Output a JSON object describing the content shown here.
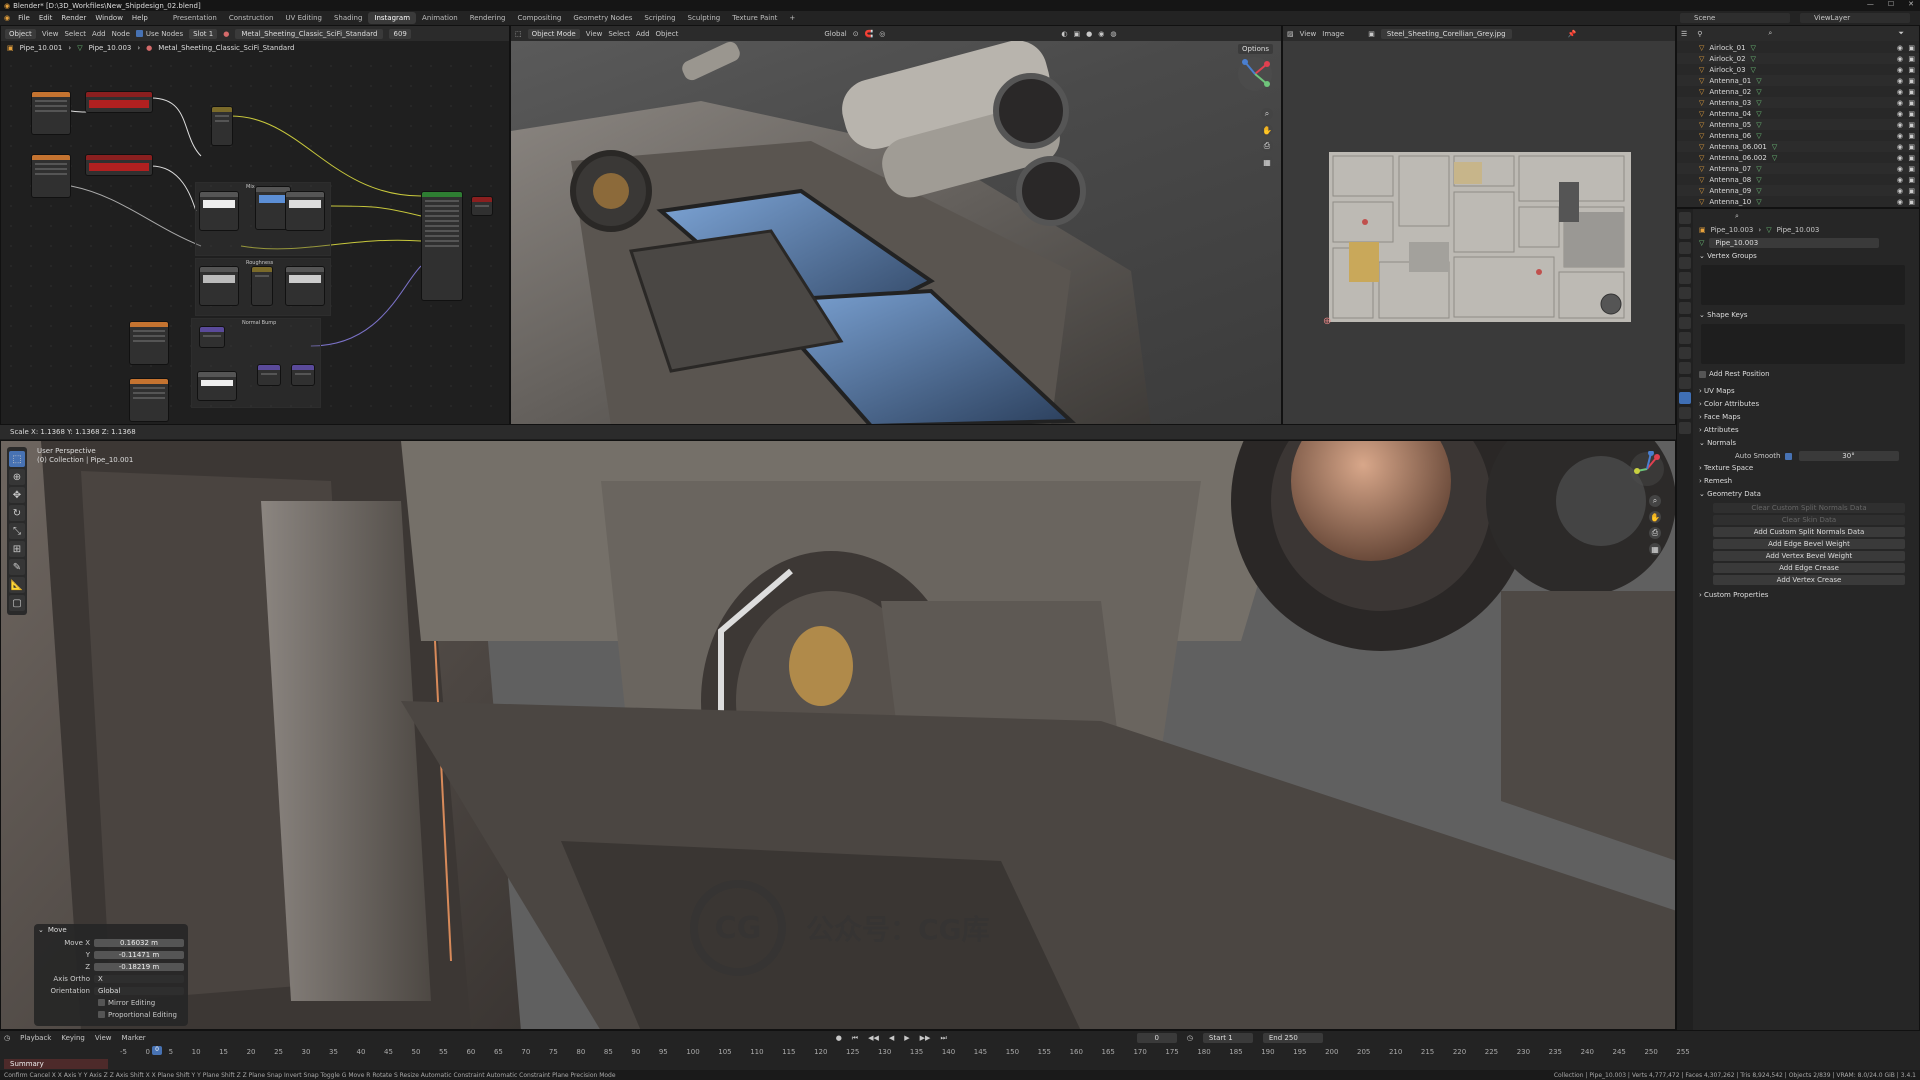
{
  "window": {
    "title": "Blender* [D:\\3D_Workfiles\\New_Shipdesign_02.blend]",
    "ctrl_min": "—",
    "ctrl_max": "☐",
    "ctrl_close": "✕"
  },
  "menus": [
    "File",
    "Edit",
    "Render",
    "Window",
    "Help"
  ],
  "workspaces": [
    "Presentation",
    "Construction",
    "UV Editing",
    "Shading",
    "Instagram",
    "Animation",
    "Rendering",
    "Compositing",
    "Geometry Nodes",
    "Scripting",
    "Sculpting",
    "Texture Paint"
  ],
  "active_workspace_index": 4,
  "scene": {
    "label": "Scene",
    "view_layer": "ViewLayer"
  },
  "node_editor": {
    "mode": "Object",
    "menu": [
      "View",
      "Select",
      "Add",
      "Node"
    ],
    "use_nodes": "Use Nodes",
    "slot": "Slot 1",
    "material": "Metal_Sheeting_Classic_SciFi_Standard",
    "users": "609",
    "breadcrumb": [
      "Pipe_10.001",
      "Pipe_10.003",
      "Metal_Sheeting_Classic_SciFi_Standard"
    ],
    "frame_label_1": "Mix",
    "frame_label_2": "Roughness",
    "frame_label_3": "Normal Bump"
  },
  "view3d_top": {
    "mode": "Object Mode",
    "menu": [
      "View",
      "Select",
      "Add",
      "Object"
    ],
    "transform": "Global",
    "options": "Options"
  },
  "image_editor": {
    "menu": [
      "View",
      "Image"
    ],
    "image_name": "Steel_Sheeting_Corellian_Grey.jpg"
  },
  "outliner": {
    "items": [
      "Airlock_01",
      "Airlock_02",
      "Airlock_03",
      "Antenna_01",
      "Antenna_02",
      "Antenna_03",
      "Antenna_04",
      "Antenna_05",
      "Antenna_06",
      "Antenna_06.001",
      "Antenna_06.002",
      "Antenna_07",
      "Antenna_08",
      "Antenna_09",
      "Antenna_10"
    ]
  },
  "properties": {
    "breadcrumb": [
      "Pipe_10.003",
      "Pipe_10.003"
    ],
    "mesh_name": "Pipe_10.003",
    "sections": {
      "vertex_groups": "Vertex Groups",
      "shape_keys": "Shape Keys",
      "add_rest_position": "Add Rest Position",
      "uv_maps": "UV Maps",
      "color_attributes": "Color Attributes",
      "face_maps": "Face Maps",
      "attributes": "Attributes",
      "normals": "Normals",
      "auto_smooth": "Auto Smooth",
      "auto_smooth_angle": "30°",
      "texture_space": "Texture Space",
      "remesh": "Remesh",
      "geometry_data": "Geometry Data",
      "custom_properties": "Custom Properties"
    },
    "geometry_buttons": [
      "Clear Custom Split Normals Data",
      "Clear Skin Data",
      "Add Custom Split Normals Data",
      "Add Edge Bevel Weight",
      "Add Vertex Bevel Weight",
      "Add Edge Crease",
      "Add Vertex Crease"
    ]
  },
  "status_scale": "Scale X: 1.1368   Y: 1.1368   Z: 1.1368",
  "view3d_main": {
    "perspective": "User Perspective",
    "collection": "(0) Collection | Pipe_10.001"
  },
  "operator_panel": {
    "title": "Move",
    "move_x_label": "Move X",
    "move_x": "0.16032 m",
    "y_label": "Y",
    "y": "-0.11471 m",
    "z_label": "Z",
    "z": "-0.18219 m",
    "axis_ortho_label": "Axis Ortho",
    "axis_ortho": "X",
    "orientation_label": "Orientation",
    "orientation": "Global",
    "mirror_editing": "Mirror Editing",
    "proportional_editing": "Proportional Editing"
  },
  "timeline": {
    "menu": [
      "Playback",
      "Keying",
      "View",
      "Marker"
    ],
    "current_frame": "0",
    "start_label": "Start",
    "start": "1",
    "end_label": "End",
    "end": "250",
    "frame_field": "0",
    "summary": "Summary",
    "ticks": [
      "-5",
      "0",
      "5",
      "10",
      "15",
      "20",
      "25",
      "30",
      "35",
      "40",
      "45",
      "50",
      "55",
      "60",
      "65",
      "70",
      "75",
      "80",
      "85",
      "90",
      "95",
      "100",
      "105",
      "110",
      "115",
      "120",
      "125",
      "130",
      "135",
      "140",
      "145",
      "150",
      "155",
      "160",
      "165",
      "170",
      "175",
      "180",
      "185",
      "190",
      "195",
      "200",
      "205",
      "210",
      "215",
      "220",
      "225",
      "230",
      "235",
      "240",
      "245",
      "250",
      "255"
    ]
  },
  "statusbar": {
    "left": "Confirm   Cancel   X X Axis   Y Y Axis   Z Z Axis   Shift X X Plane   Shift Y Y Plane   Shift Z Z Plane   Snap Invert   Snap Toggle   G Move   R Rotate   S Resize   Automatic Constraint   Automatic Constraint Plane   Precision Mode",
    "right": "Collection | Pipe_10.003 | Verts 4,777,472 | Faces 4,307,262 | Tris 8,924,542 | Objects 2/839 | VRAM: 8.0/24.0 GiB | 3.4.1"
  },
  "watermark": {
    "logo": "CG",
    "text": "公众号：CG库"
  },
  "colors": {
    "accent": "#4772b3",
    "object_orange": "#e8a23c",
    "mesh_green": "#6fc57b"
  }
}
